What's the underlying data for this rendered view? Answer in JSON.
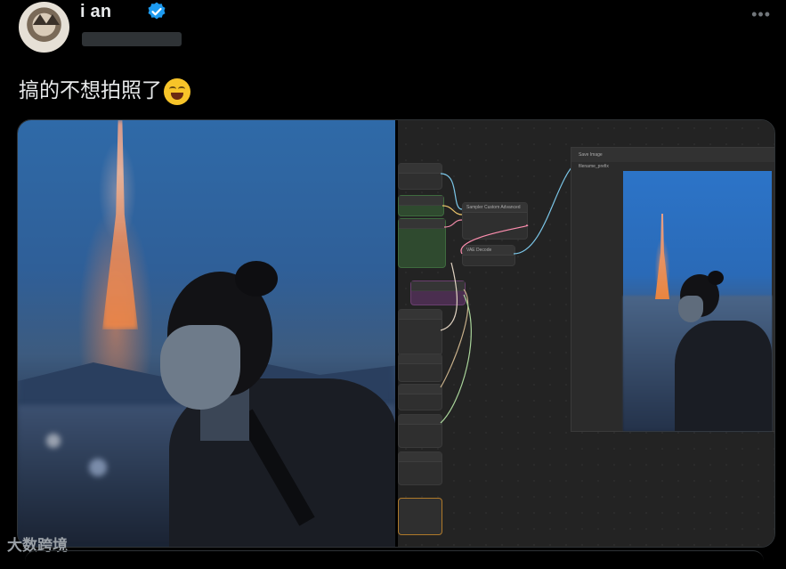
{
  "tweet": {
    "author_name": "i  an",
    "more_label": "•••",
    "text": "搞的不想拍照了",
    "emoji": "😂"
  },
  "media": {
    "left_image": "photo of woman in front of Tokyo Tower at dusk",
    "right_image": "ComfyUI node workflow with preview",
    "workflow": {
      "node_labels": [
        "Sampler Custom Advanced",
        "VAE Decode",
        "Save Image"
      ],
      "save_image_field": "filename_prefix"
    }
  },
  "watermark": "大数跨境"
}
